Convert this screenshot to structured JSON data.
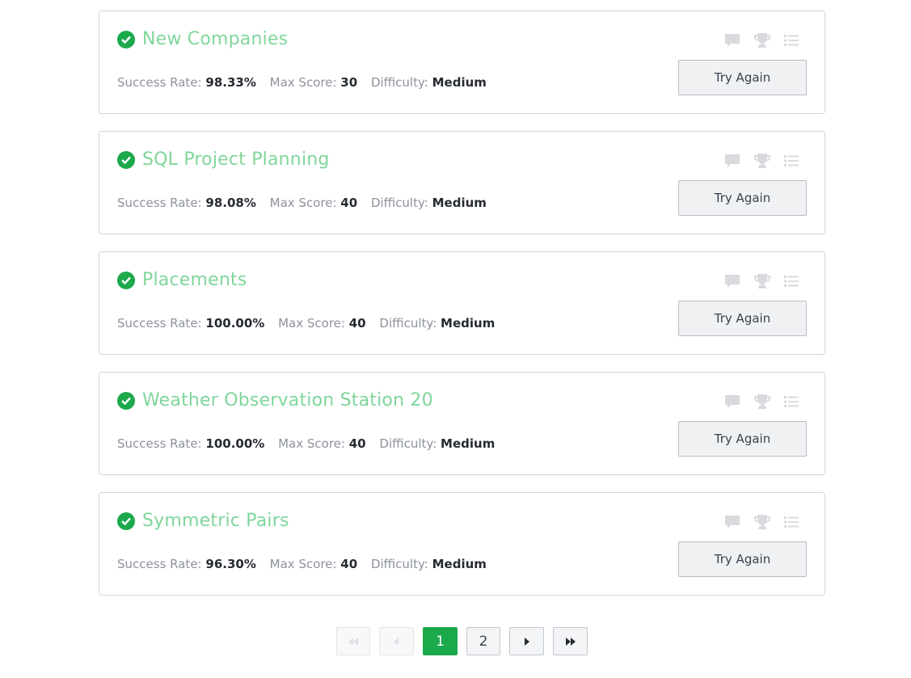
{
  "challenges": [
    {
      "title": "New Companies",
      "success_label": "Success Rate:",
      "success": "98.33%",
      "score_label": "Max Score:",
      "score": "30",
      "difficulty_label": "Difficulty:",
      "difficulty": "Medium",
      "button": "Try Again"
    },
    {
      "title": "SQL Project Planning",
      "success_label": "Success Rate:",
      "success": "98.08%",
      "score_label": "Max Score:",
      "score": "40",
      "difficulty_label": "Difficulty:",
      "difficulty": "Medium",
      "button": "Try Again"
    },
    {
      "title": "Placements",
      "success_label": "Success Rate:",
      "success": "100.00%",
      "score_label": "Max Score:",
      "score": "40",
      "difficulty_label": "Difficulty:",
      "difficulty": "Medium",
      "button": "Try Again"
    },
    {
      "title": "Weather Observation Station 20",
      "success_label": "Success Rate:",
      "success": "100.00%",
      "score_label": "Max Score:",
      "score": "40",
      "difficulty_label": "Difficulty:",
      "difficulty": "Medium",
      "button": "Try Again"
    },
    {
      "title": "Symmetric Pairs",
      "success_label": "Success Rate:",
      "success": "96.30%",
      "score_label": "Max Score:",
      "score": "40",
      "difficulty_label": "Difficulty:",
      "difficulty": "Medium",
      "button": "Try Again"
    }
  ],
  "icons": [
    "check-icon",
    "discussion-icon",
    "trophy-icon",
    "list-icon"
  ],
  "pagination": {
    "pages": [
      "1",
      "2"
    ],
    "current": "1",
    "first_icon": "double-left-icon",
    "prev_icon": "left-icon",
    "next_icon": "right-icon",
    "last_icon": "double-right-icon"
  },
  "colors": {
    "accent": "#1ba94c",
    "title": "#7fd69b",
    "label": "#8d929c",
    "value": "#262a31",
    "icon": "#d8dade"
  }
}
